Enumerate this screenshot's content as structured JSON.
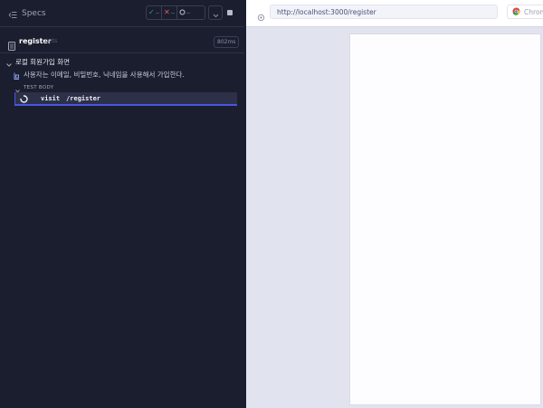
{
  "topbar": {
    "specs_label": "Specs",
    "stats": {
      "passed": "--",
      "failed": "--",
      "pending": "--"
    }
  },
  "spec": {
    "name": "register",
    "ext": ".cy.ts",
    "duration": "802ms"
  },
  "suite": {
    "title": "로컬 회원가입 화면"
  },
  "test": {
    "title": "사용자는 이메일, 비밀번호, 닉네임을 사용해서 가입한다."
  },
  "section": {
    "title": "TEST BODY"
  },
  "command": {
    "name": "visit",
    "message": "/register"
  },
  "preview": {
    "url": "http://localhost:3000/register",
    "browser": "Chrome"
  },
  "colors": {
    "panel_bg": "#1b1e2e",
    "accent": "#4956e3",
    "pass": "#1fa971",
    "fail": "#e45770",
    "preview_bg": "#e1e3ef"
  }
}
